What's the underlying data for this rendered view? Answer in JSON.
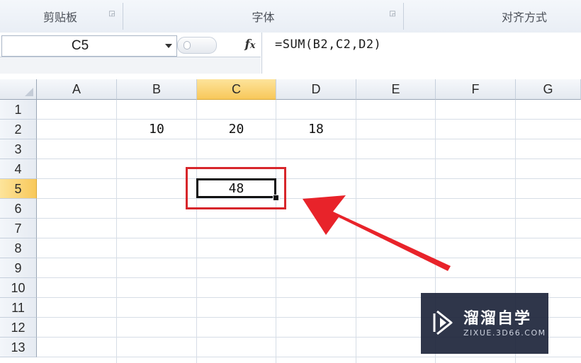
{
  "ribbon": {
    "groups": [
      "剪贴板",
      "字体",
      "对齐方式"
    ]
  },
  "formula_bar": {
    "name_box": "C5",
    "fx_label": "fx",
    "formula": "=SUM(B2,C2,D2)"
  },
  "sheet": {
    "columns": [
      "A",
      "B",
      "C",
      "D",
      "E",
      "F",
      "G"
    ],
    "rows": [
      "1",
      "2",
      "3",
      "4",
      "5",
      "6",
      "7",
      "8",
      "9",
      "10",
      "11",
      "12",
      "13"
    ],
    "selected_column": "C",
    "selected_row": "5",
    "cells": {
      "B2": "10",
      "C2": "20",
      "D2": "18",
      "C5": "48"
    }
  },
  "annotation": {
    "highlight_color": "#d7262b",
    "arrow_color": "#e8232a"
  },
  "watermark": {
    "name": "溜溜自学",
    "url": "ZIXUE.3D66.COM"
  },
  "icons": [
    "dialog-launcher-icon",
    "dropdown-arrow-icon",
    "fx-icon",
    "select-all-icon",
    "play-logo-icon"
  ]
}
